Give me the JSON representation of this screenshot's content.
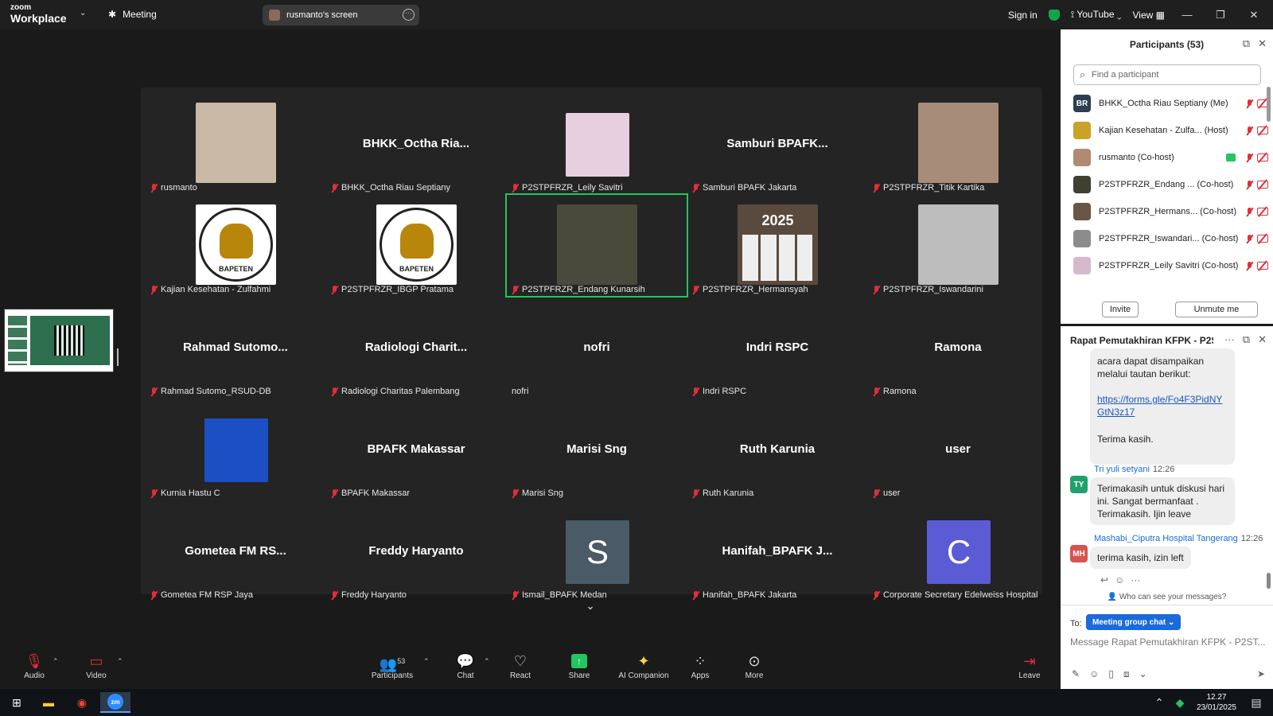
{
  "topbar": {
    "logo_line1": "zoom",
    "logo_line2": "Workplace",
    "meeting_label": "Meeting",
    "screen_label": "rusmanto's screen",
    "signin": "Sign in",
    "youtube": "YouTube",
    "view": "View"
  },
  "tiles": [
    {
      "name": "rusmanto",
      "big": "",
      "kind": "photo",
      "color": "#c9b9a6"
    },
    {
      "name": "BHKK_Octha Riau Septiany",
      "big": "BHKK_Octha  Ria...",
      "kind": "name"
    },
    {
      "name": "P2STPFRZR_Leily Savitri",
      "big": "",
      "kind": "photo-sm",
      "color": "#e8cfe0"
    },
    {
      "name": "Samburi BPAFK Jakarta",
      "big": "Samburi  BPAFK...",
      "kind": "name"
    },
    {
      "name": "P2STPFRZR_Titik Kartika",
      "big": "",
      "kind": "photo",
      "color": "#a88c7a"
    },
    {
      "name": "Kajian Kesehatan - Zulfahmi",
      "big": "",
      "kind": "logo"
    },
    {
      "name": "P2STPFRZR_IBGP Pratama",
      "big": "",
      "kind": "logo"
    },
    {
      "name": "P2STPFRZR_Endang Kunarsih",
      "big": "",
      "kind": "photo",
      "color": "#4a4a3a",
      "active": true
    },
    {
      "name": "P2STPFRZR_Hermansyah",
      "big": "",
      "kind": "photo",
      "color": "#5a4a3e"
    },
    {
      "name": "P2STPFRZR_Iswandarini",
      "big": "",
      "kind": "photo",
      "color": "#bdbdbd"
    },
    {
      "name": "Rahmad Sutomo_RSUD-DB",
      "big": "Rahmad  Sutomo...",
      "kind": "name"
    },
    {
      "name": "Radiologi Charitas Palembang",
      "big": "Radiologi  Charit...",
      "kind": "name"
    },
    {
      "name": "nofri",
      "big": "nofri",
      "kind": "name",
      "unmuted": true
    },
    {
      "name": "Indri RSPC",
      "big": "Indri RSPC",
      "kind": "name"
    },
    {
      "name": "Ramona",
      "big": "Ramona",
      "kind": "name"
    },
    {
      "name": "Kurnia Hastu C",
      "big": "",
      "kind": "photo-sm",
      "color": "#1d4fc4"
    },
    {
      "name": "BPAFK Makassar",
      "big": "BPAFK Makassar",
      "kind": "name"
    },
    {
      "name": "Marisi Sng",
      "big": "Marisi Sng",
      "kind": "name"
    },
    {
      "name": "Ruth Karunia",
      "big": "Ruth Karunia",
      "kind": "name"
    },
    {
      "name": "user",
      "big": "user",
      "kind": "name"
    },
    {
      "name": "Gometea FM RSP Jaya",
      "big": "Gometea  FM  RS...",
      "kind": "name"
    },
    {
      "name": "Freddy Haryanto",
      "big": "Freddy Haryanto",
      "kind": "name"
    },
    {
      "name": "Ismail_BPAFK Medan",
      "big": "S",
      "kind": "letter",
      "color": "#4a5a66"
    },
    {
      "name": "Hanifah_BPAFK Jakarta",
      "big": "Hanifah_BPAFK  J...",
      "kind": "name"
    },
    {
      "name": "Corporate Secretary Edelweiss Hospital",
      "big": "C",
      "kind": "letter",
      "color": "#5b5bd6"
    }
  ],
  "photo_text": {
    "calendar_word": "2025",
    "logo_word": "BAPETEN"
  },
  "participants_panel": {
    "title": "Participants (53)",
    "search_placeholder": "Find a participant",
    "rows": [
      {
        "name": "BHKK_Octha Riau Septiany (Me)",
        "initials": "BR",
        "color": "#2d3e50",
        "share": false
      },
      {
        "name": "Kajian Kesehatan - Zulfa... (Host)",
        "initials": "",
        "color": "#c9a227",
        "share": false
      },
      {
        "name": "rusmanto (Co-host)",
        "initials": "",
        "color": "#b08a72",
        "share": true
      },
      {
        "name": "P2STPFRZR_Endang ... (Co-host)",
        "initials": "",
        "color": "#3f3f32",
        "share": false
      },
      {
        "name": "P2STPFRZR_Hermans... (Co-host)",
        "initials": "",
        "color": "#6a5646",
        "share": false
      },
      {
        "name": "P2STPFRZR_Iswandari... (Co-host)",
        "initials": "",
        "color": "#8c8c8c",
        "share": false
      },
      {
        "name": "P2STPFRZR_Leily Savitri (Co-host)",
        "initials": "",
        "color": "#d6b9cc",
        "share": false
      }
    ],
    "invite": "Invite",
    "unmute": "Unmute me"
  },
  "chat_panel": {
    "title": "Rapat Pemutakhiran KFPK - P2ST...",
    "msg1_text": "acara dapat disampaikan melalui tautan berikut:",
    "msg1_link": "https://forms.gle/Fo4F3PidNYGtN3z17",
    "msg1_thanks": "Terima kasih.",
    "msg2_sender": "Tri yuli setyani",
    "msg2_time": "12:26",
    "msg2_initials": "TY",
    "msg2_text": "Terimakasih untuk diskusi hari ini. Sangat bermanfaat . Terimakasih. Ijin leave",
    "msg3_sender": "Mashabi_Ciputra Hospital Tangerang",
    "msg3_time": "12:26",
    "msg3_initials": "MH",
    "msg3_text": "terima kasih, izin left",
    "who_see": "Who can see your messages?",
    "to_label": "To:",
    "to_target": "Meeting group chat",
    "input_placeholder": "Message Rapat Pemutakhiran KFPK - P2ST..."
  },
  "toolbar": {
    "audio": "Audio",
    "video": "Video",
    "participants": "Participants",
    "participants_count": "53",
    "chat": "Chat",
    "react": "React",
    "share": "Share",
    "ai": "AI Companion",
    "apps": "Apps",
    "more": "More",
    "leave": "Leave"
  },
  "taskbar": {
    "time": "12.27",
    "date": "23/01/2025"
  }
}
